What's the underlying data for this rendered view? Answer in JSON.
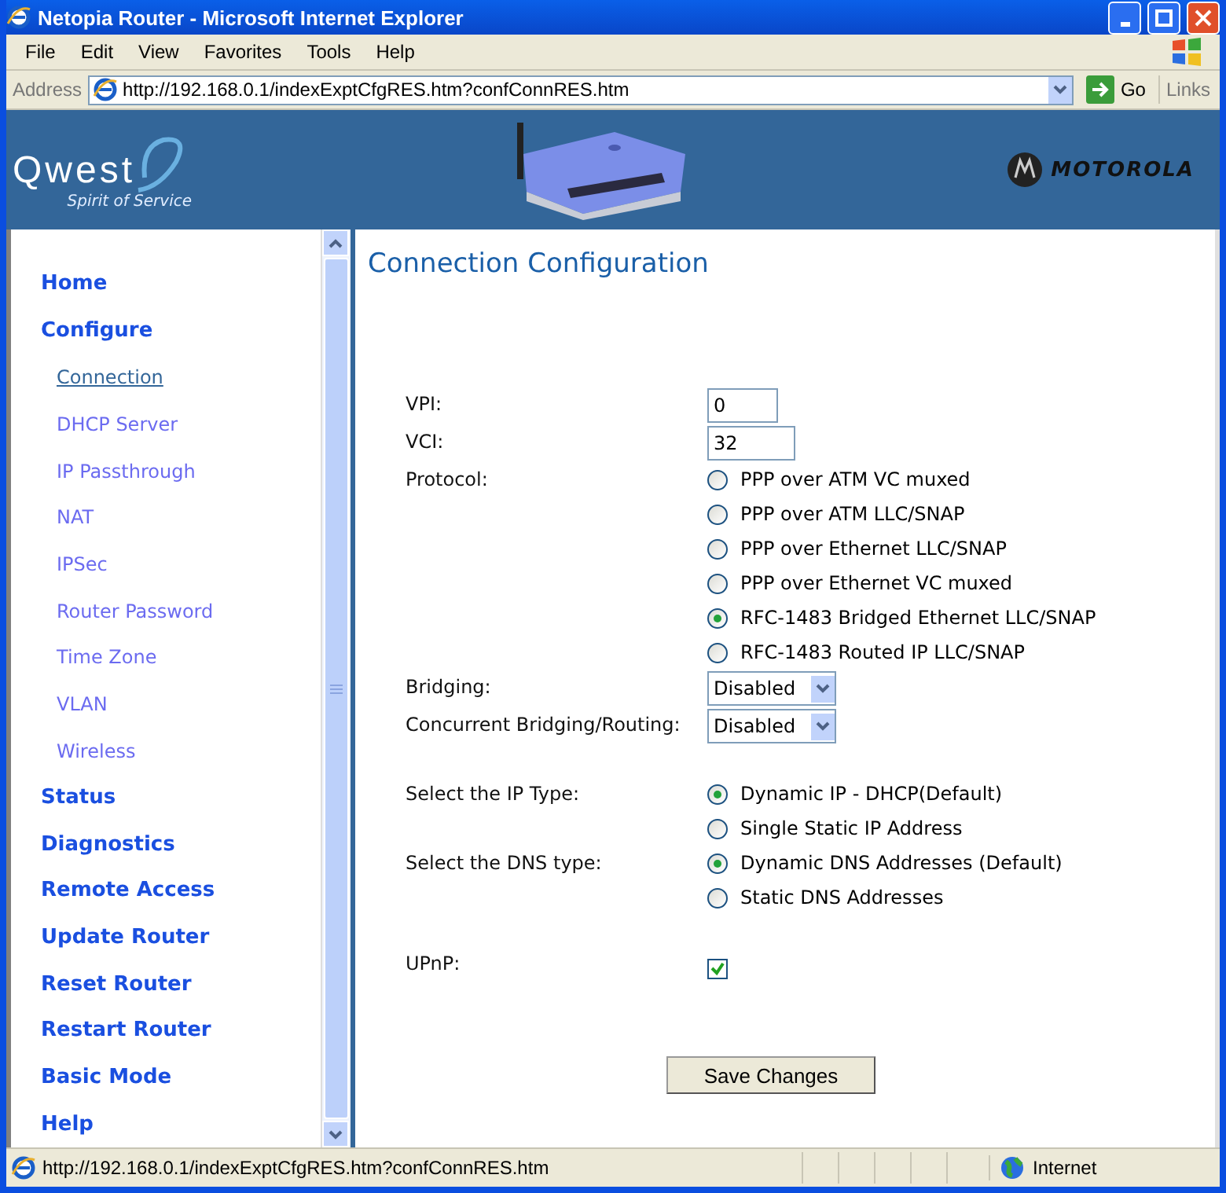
{
  "window": {
    "title": "Netopia Router - Microsoft Internet Explorer"
  },
  "menu": [
    "File",
    "Edit",
    "View",
    "Favorites",
    "Tools",
    "Help"
  ],
  "address_bar": {
    "label": "Address",
    "url": "http://192.168.0.1/indexExptCfgRES.htm?confConnRES.htm",
    "go": "Go",
    "links": "Links"
  },
  "banner": {
    "brand": "Qwest",
    "tagline": "Spirit of Service",
    "partner": "MOTOROLA"
  },
  "sidebar": {
    "items": [
      {
        "label": "Home",
        "kind": "section",
        "selected": false
      },
      {
        "label": "Configure",
        "kind": "section",
        "selected": false
      },
      {
        "label": "Connection",
        "kind": "sub",
        "selected": true
      },
      {
        "label": "DHCP Server",
        "kind": "sub",
        "selected": false
      },
      {
        "label": "IP Passthrough",
        "kind": "sub",
        "selected": false
      },
      {
        "label": "NAT",
        "kind": "sub",
        "selected": false
      },
      {
        "label": "IPSec",
        "kind": "sub",
        "selected": false
      },
      {
        "label": "Router Password",
        "kind": "sub",
        "selected": false
      },
      {
        "label": "Time Zone",
        "kind": "sub",
        "selected": false
      },
      {
        "label": "VLAN",
        "kind": "sub",
        "selected": false
      },
      {
        "label": "Wireless",
        "kind": "sub",
        "selected": false
      },
      {
        "label": "Status",
        "kind": "section",
        "selected": false
      },
      {
        "label": "Diagnostics",
        "kind": "section",
        "selected": false
      },
      {
        "label": "Remote Access",
        "kind": "section",
        "selected": false
      },
      {
        "label": "Update Router",
        "kind": "section",
        "selected": false
      },
      {
        "label": "Reset Router",
        "kind": "section",
        "selected": false
      },
      {
        "label": "Restart Router",
        "kind": "section",
        "selected": false
      },
      {
        "label": "Basic Mode",
        "kind": "section",
        "selected": false
      },
      {
        "label": "Help",
        "kind": "section",
        "selected": false
      }
    ]
  },
  "page": {
    "title": "Connection Configuration",
    "rows": [
      {
        "kind": "text",
        "label": "VPI:",
        "value": "0"
      },
      {
        "kind": "text",
        "label": "VCI:",
        "value": "32"
      },
      {
        "kind": "radio",
        "label": "Protocol:",
        "options": [
          {
            "label": "PPP over ATM VC muxed",
            "selected": false
          },
          {
            "label": "PPP over ATM LLC/SNAP",
            "selected": false
          },
          {
            "label": "PPP over Ethernet LLC/SNAP",
            "selected": false
          },
          {
            "label": "PPP over Ethernet VC muxed",
            "selected": false
          },
          {
            "label": "RFC-1483 Bridged Ethernet LLC/SNAP",
            "selected": true
          },
          {
            "label": "RFC-1483 Routed IP LLC/SNAP",
            "selected": false
          }
        ]
      },
      {
        "kind": "select",
        "label": "Bridging:",
        "value": "Disabled"
      },
      {
        "kind": "select",
        "label": "Concurrent Bridging/Routing:",
        "value": "Disabled"
      },
      {
        "kind": "spacer"
      },
      {
        "kind": "radio",
        "label": "Select the IP Type:",
        "options": [
          {
            "label": "Dynamic IP - DHCP(Default)",
            "selected": true
          },
          {
            "label": "Single Static IP Address",
            "selected": false
          }
        ]
      },
      {
        "kind": "radio",
        "label": "Select the DNS type:",
        "options": [
          {
            "label": "Dynamic DNS Addresses (Default)",
            "selected": true
          },
          {
            "label": "Static DNS Addresses",
            "selected": false
          }
        ]
      },
      {
        "kind": "spacer"
      },
      {
        "kind": "checkbox",
        "label": "UPnP:",
        "checked": true
      }
    ],
    "save_button": "Save Changes"
  },
  "status_bar": {
    "url": "http://192.168.0.1/indexExptCfgRES.htm?confConnRES.htm",
    "zone": "Internet"
  }
}
